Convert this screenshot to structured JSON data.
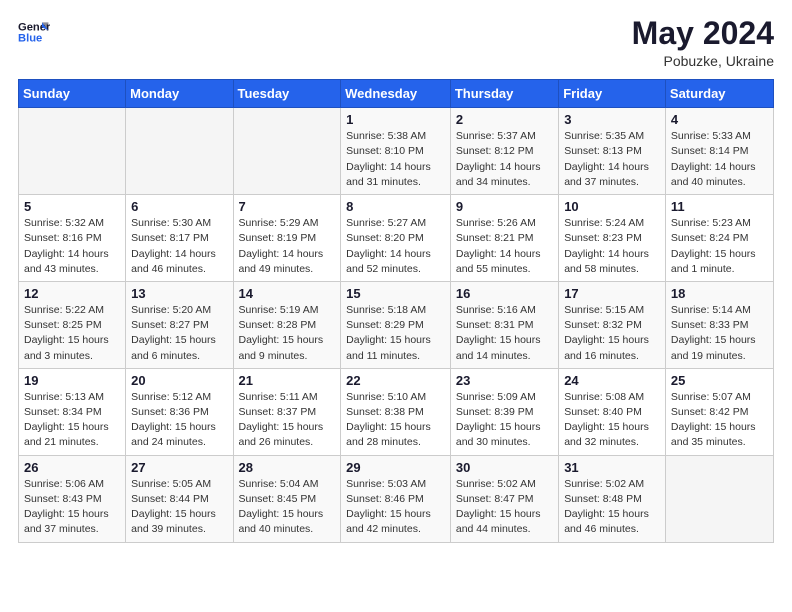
{
  "header": {
    "monthYear": "May 2024",
    "location": "Pobuzke, Ukraine"
  },
  "calendar": {
    "headers": [
      "Sunday",
      "Monday",
      "Tuesday",
      "Wednesday",
      "Thursday",
      "Friday",
      "Saturday"
    ],
    "rows": [
      [
        {
          "day": "",
          "info": ""
        },
        {
          "day": "",
          "info": ""
        },
        {
          "day": "",
          "info": ""
        },
        {
          "day": "1",
          "info": "Sunrise: 5:38 AM\nSunset: 8:10 PM\nDaylight: 14 hours\nand 31 minutes."
        },
        {
          "day": "2",
          "info": "Sunrise: 5:37 AM\nSunset: 8:12 PM\nDaylight: 14 hours\nand 34 minutes."
        },
        {
          "day": "3",
          "info": "Sunrise: 5:35 AM\nSunset: 8:13 PM\nDaylight: 14 hours\nand 37 minutes."
        },
        {
          "day": "4",
          "info": "Sunrise: 5:33 AM\nSunset: 8:14 PM\nDaylight: 14 hours\nand 40 minutes."
        }
      ],
      [
        {
          "day": "5",
          "info": "Sunrise: 5:32 AM\nSunset: 8:16 PM\nDaylight: 14 hours\nand 43 minutes."
        },
        {
          "day": "6",
          "info": "Sunrise: 5:30 AM\nSunset: 8:17 PM\nDaylight: 14 hours\nand 46 minutes."
        },
        {
          "day": "7",
          "info": "Sunrise: 5:29 AM\nSunset: 8:19 PM\nDaylight: 14 hours\nand 49 minutes."
        },
        {
          "day": "8",
          "info": "Sunrise: 5:27 AM\nSunset: 8:20 PM\nDaylight: 14 hours\nand 52 minutes."
        },
        {
          "day": "9",
          "info": "Sunrise: 5:26 AM\nSunset: 8:21 PM\nDaylight: 14 hours\nand 55 minutes."
        },
        {
          "day": "10",
          "info": "Sunrise: 5:24 AM\nSunset: 8:23 PM\nDaylight: 14 hours\nand 58 minutes."
        },
        {
          "day": "11",
          "info": "Sunrise: 5:23 AM\nSunset: 8:24 PM\nDaylight: 15 hours\nand 1 minute."
        }
      ],
      [
        {
          "day": "12",
          "info": "Sunrise: 5:22 AM\nSunset: 8:25 PM\nDaylight: 15 hours\nand 3 minutes."
        },
        {
          "day": "13",
          "info": "Sunrise: 5:20 AM\nSunset: 8:27 PM\nDaylight: 15 hours\nand 6 minutes."
        },
        {
          "day": "14",
          "info": "Sunrise: 5:19 AM\nSunset: 8:28 PM\nDaylight: 15 hours\nand 9 minutes."
        },
        {
          "day": "15",
          "info": "Sunrise: 5:18 AM\nSunset: 8:29 PM\nDaylight: 15 hours\nand 11 minutes."
        },
        {
          "day": "16",
          "info": "Sunrise: 5:16 AM\nSunset: 8:31 PM\nDaylight: 15 hours\nand 14 minutes."
        },
        {
          "day": "17",
          "info": "Sunrise: 5:15 AM\nSunset: 8:32 PM\nDaylight: 15 hours\nand 16 minutes."
        },
        {
          "day": "18",
          "info": "Sunrise: 5:14 AM\nSunset: 8:33 PM\nDaylight: 15 hours\nand 19 minutes."
        }
      ],
      [
        {
          "day": "19",
          "info": "Sunrise: 5:13 AM\nSunset: 8:34 PM\nDaylight: 15 hours\nand 21 minutes."
        },
        {
          "day": "20",
          "info": "Sunrise: 5:12 AM\nSunset: 8:36 PM\nDaylight: 15 hours\nand 24 minutes."
        },
        {
          "day": "21",
          "info": "Sunrise: 5:11 AM\nSunset: 8:37 PM\nDaylight: 15 hours\nand 26 minutes."
        },
        {
          "day": "22",
          "info": "Sunrise: 5:10 AM\nSunset: 8:38 PM\nDaylight: 15 hours\nand 28 minutes."
        },
        {
          "day": "23",
          "info": "Sunrise: 5:09 AM\nSunset: 8:39 PM\nDaylight: 15 hours\nand 30 minutes."
        },
        {
          "day": "24",
          "info": "Sunrise: 5:08 AM\nSunset: 8:40 PM\nDaylight: 15 hours\nand 32 minutes."
        },
        {
          "day": "25",
          "info": "Sunrise: 5:07 AM\nSunset: 8:42 PM\nDaylight: 15 hours\nand 35 minutes."
        }
      ],
      [
        {
          "day": "26",
          "info": "Sunrise: 5:06 AM\nSunset: 8:43 PM\nDaylight: 15 hours\nand 37 minutes."
        },
        {
          "day": "27",
          "info": "Sunrise: 5:05 AM\nSunset: 8:44 PM\nDaylight: 15 hours\nand 39 minutes."
        },
        {
          "day": "28",
          "info": "Sunrise: 5:04 AM\nSunset: 8:45 PM\nDaylight: 15 hours\nand 40 minutes."
        },
        {
          "day": "29",
          "info": "Sunrise: 5:03 AM\nSunset: 8:46 PM\nDaylight: 15 hours\nand 42 minutes."
        },
        {
          "day": "30",
          "info": "Sunrise: 5:02 AM\nSunset: 8:47 PM\nDaylight: 15 hours\nand 44 minutes."
        },
        {
          "day": "31",
          "info": "Sunrise: 5:02 AM\nSunset: 8:48 PM\nDaylight: 15 hours\nand 46 minutes."
        },
        {
          "day": "",
          "info": ""
        }
      ]
    ]
  }
}
